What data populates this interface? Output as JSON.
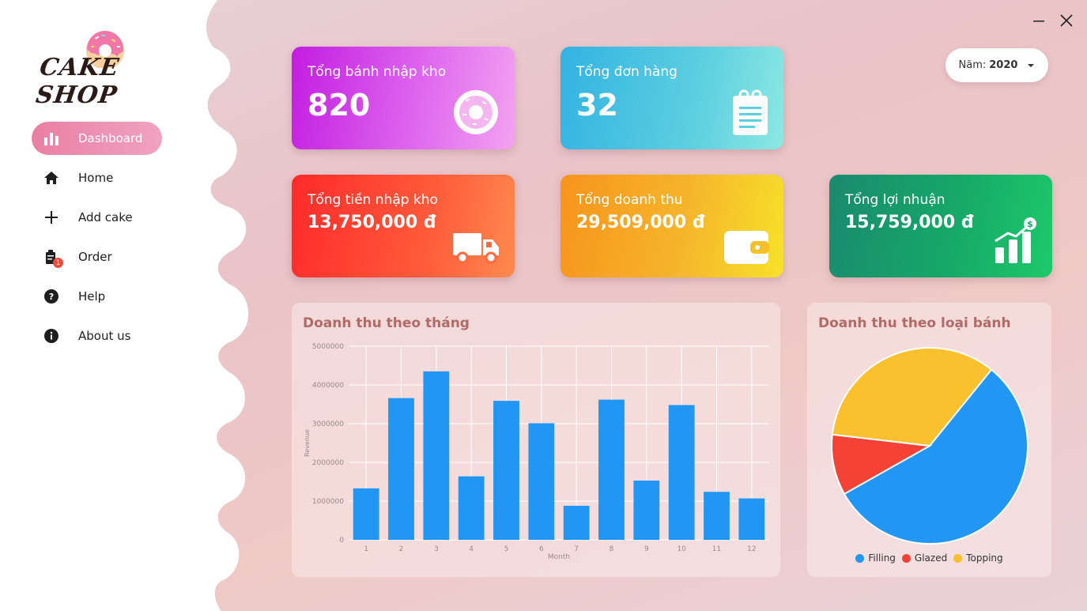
{
  "window": {
    "minimize_icon": "minus-icon",
    "close_icon": "x-icon"
  },
  "brand": {
    "name": "CAKE SHOP"
  },
  "sidebar": {
    "items": [
      {
        "label": "Dashboard",
        "icon": "bar-chart-icon",
        "active": true
      },
      {
        "label": "Home",
        "icon": "home-icon"
      },
      {
        "label": "Add cake",
        "icon": "plus-icon"
      },
      {
        "label": "Order",
        "icon": "order-icon",
        "badge": "1"
      },
      {
        "label": "Help",
        "icon": "help-icon"
      },
      {
        "label": "About us",
        "icon": "info-icon"
      }
    ]
  },
  "year_select": {
    "label": "Năm:",
    "value": "2020"
  },
  "cards": {
    "stock_cakes": {
      "label": "Tổng bánh nhập kho",
      "value": "820",
      "icon": "donut-icon"
    },
    "orders": {
      "label": "Tổng đơn hàng",
      "value": "32",
      "icon": "clipboard-icon"
    },
    "stock_cost": {
      "label": "Tổng tiền nhập kho",
      "value": "13,750,000 đ",
      "icon": "truck-icon"
    },
    "revenue": {
      "label": "Tổng doanh thu",
      "value": "29,509,000 đ",
      "icon": "wallet-icon"
    },
    "profit": {
      "label": "Tổng lợi nhuận",
      "value": "15,759,000 đ",
      "icon": "growth-chart-icon"
    }
  },
  "colors": {
    "bar": "#2196f3",
    "filling": "#2196f3",
    "glazed": "#f44336",
    "topping": "#fbc02d"
  },
  "chart_data": [
    {
      "type": "bar",
      "title": "Doanh thu theo tháng",
      "xlabel": "Month",
      "ylabel": "Revenue",
      "ylim": [
        0,
        5000000
      ],
      "yticks": [
        "0",
        "1000000",
        "2000000",
        "3000000",
        "4000000",
        "5000000"
      ],
      "categories": [
        "1",
        "2",
        "3",
        "4",
        "5",
        "6",
        "7",
        "8",
        "9",
        "10",
        "11",
        "12"
      ],
      "values": [
        1330000,
        3660000,
        4350000,
        1640000,
        3590000,
        3010000,
        880000,
        3620000,
        1530000,
        3480000,
        1240000,
        1070000
      ],
      "grid": true
    },
    {
      "type": "pie",
      "title": "Doanh thu theo loại bánh",
      "legend": "bottom",
      "slices": [
        {
          "name": "Filling",
          "value": 56
        },
        {
          "name": "Glazed",
          "value": 10
        },
        {
          "name": "Topping",
          "value": 34
        }
      ]
    }
  ]
}
